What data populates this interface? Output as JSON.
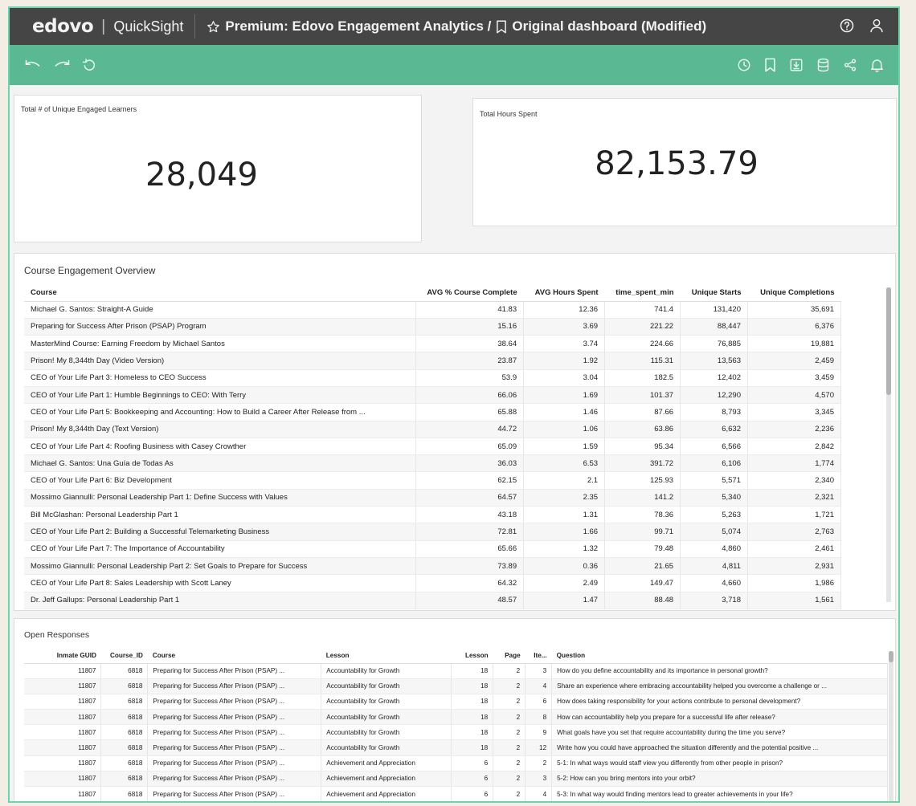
{
  "app": {
    "logo": "edovo",
    "separator": "|",
    "product": "QuickSight",
    "title_prefix": "Premium: Edovo Engagement Analytics /",
    "dashboard_name": "Original dashboard (Modified)"
  },
  "icons": {
    "topbar": [
      "star-icon",
      "bookmark-icon",
      "help-icon",
      "user-icon"
    ],
    "toolbar_left": [
      "undo-icon",
      "redo-icon",
      "reset-icon"
    ],
    "toolbar_right": [
      "schedule-icon",
      "bookmark-icon",
      "download-icon",
      "dataset-icon",
      "share-icon",
      "alert-icon"
    ]
  },
  "colors": {
    "topbar": "#454545",
    "toolbar": "#5ab892",
    "frame_border": "#6dd3a8"
  },
  "kpis": {
    "learners": {
      "label": "Total # of Unique Engaged Learners",
      "value": "28,049"
    },
    "hours": {
      "label": "Total Hours Spent",
      "value": "82,153.79"
    }
  },
  "course_engagement": {
    "title": "Course Engagement Overview",
    "columns": [
      "Course",
      "AVG % Course Complete",
      "AVG Hours Spent",
      "time_spent_min",
      "Unique Starts",
      "Unique Completions"
    ],
    "rows": [
      [
        "Michael G. Santos: Straight-A Guide",
        "41.83",
        "12.36",
        "741.4",
        "131,420",
        "35,691"
      ],
      [
        "Preparing for Success After Prison (PSAP) Program",
        "15.16",
        "3.69",
        "221.22",
        "88,447",
        "6,376"
      ],
      [
        "MasterMind Course: Earning Freedom by Michael Santos",
        "38.64",
        "3.74",
        "224.66",
        "76,885",
        "19,881"
      ],
      [
        "Prison! My 8,344th Day (Video Version)",
        "23.87",
        "1.92",
        "115.31",
        "13,563",
        "2,459"
      ],
      [
        "CEO of Your Life Part 3: Homeless to CEO Success",
        "53.9",
        "3.04",
        "182.5",
        "12,402",
        "3,459"
      ],
      [
        "CEO of Your Life Part 1: Humble Beginnings to CEO: With Terry",
        "66.06",
        "1.69",
        "101.37",
        "12,290",
        "4,570"
      ],
      [
        "CEO of Your Life Part 5: Bookkeeping and Accounting: How to Build a Career After Release from ...",
        "65.88",
        "1.46",
        "87.66",
        "8,793",
        "3,345"
      ],
      [
        "Prison! My 8,344th Day (Text Version)",
        "44.72",
        "1.06",
        "63.86",
        "6,632",
        "2,236"
      ],
      [
        "CEO of Your Life Part 4: Roofing Business with Casey Crowther",
        "65.09",
        "1.59",
        "95.34",
        "6,566",
        "2,842"
      ],
      [
        "Michael G. Santos: Una Guía de Todas As",
        "36.03",
        "6.53",
        "391.72",
        "6,106",
        "1,774"
      ],
      [
        "CEO of Your Life Part 6: Biz Development",
        "62.15",
        "2.1",
        "125.93",
        "5,571",
        "2,340"
      ],
      [
        "Mossimo Giannulli: Personal Leadership Part 1: Define Success with Values",
        "64.57",
        "2.35",
        "141.2",
        "5,340",
        "2,321"
      ],
      [
        "Bill McGlashan: Personal Leadership Part 1",
        "43.18",
        "1.31",
        "78.36",
        "5,263",
        "1,721"
      ],
      [
        "CEO of Your Life Part 2: Building a Successful Telemarketing Business",
        "72.81",
        "1.66",
        "99.71",
        "5,074",
        "2,763"
      ],
      [
        "CEO of Your Life Part 7: The Importance of Accountability",
        "65.66",
        "1.32",
        "79.48",
        "4,860",
        "2,461"
      ],
      [
        "Mossimo Giannulli: Personal Leadership Part 2: Set Goals to Prepare for Success",
        "73.89",
        "0.36",
        "21.65",
        "4,811",
        "2,931"
      ],
      [
        "CEO of Your Life Part 8: Sales Leadership with Scott Laney",
        "64.32",
        "2.49",
        "149.47",
        "4,660",
        "1,986"
      ],
      [
        "Dr. Jeff Gallups: Personal Leadership Part 1",
        "48.57",
        "1.47",
        "88.48",
        "3,718",
        "1,561"
      ]
    ]
  },
  "open_responses": {
    "title": "Open Responses",
    "columns": [
      "Inmate GUID",
      "Course_ID",
      "Course",
      "Lesson",
      "Lesson",
      "Page",
      "Ite...",
      "Question"
    ],
    "rows": [
      [
        "11807",
        "6818",
        "Preparing for Success After Prison (PSAP) ...",
        "Accountability for Growth",
        "18",
        "2",
        "3",
        "How do you define accountability and its importance in personal growth?"
      ],
      [
        "11807",
        "6818",
        "Preparing for Success After Prison (PSAP) ...",
        "Accountability for Growth",
        "18",
        "2",
        "4",
        "Share an experience where embracing accountability helped you overcome a challenge or ..."
      ],
      [
        "11807",
        "6818",
        "Preparing for Success After Prison (PSAP) ...",
        "Accountability for Growth",
        "18",
        "2",
        "6",
        "How does taking responsibility for your actions contribute to personal development?"
      ],
      [
        "11807",
        "6818",
        "Preparing for Success After Prison (PSAP) ...",
        "Accountability for Growth",
        "18",
        "2",
        "8",
        "How can accountability help you prepare for a successful life after release?"
      ],
      [
        "11807",
        "6818",
        "Preparing for Success After Prison (PSAP) ...",
        "Accountability for Growth",
        "18",
        "2",
        "9",
        "What goals have you set that require accountability during the time you serve?"
      ],
      [
        "11807",
        "6818",
        "Preparing for Success After Prison (PSAP) ...",
        "Accountability for Growth",
        "18",
        "2",
        "12",
        "Write how you could have approached the situation differently and the potential positive ..."
      ],
      [
        "11807",
        "6818",
        "Preparing for Success After Prison (PSAP) ...",
        "Achievement and Appreciation",
        "6",
        "2",
        "2",
        "5-1: In what ways would staff view you differently from other people in prison?"
      ],
      [
        "11807",
        "6818",
        "Preparing for Success After Prison (PSAP) ...",
        "Achievement and Appreciation",
        "6",
        "2",
        "3",
        "5-2: How can you bring mentors into your orbit?"
      ],
      [
        "11807",
        "6818",
        "Preparing for Success After Prison (PSAP) ...",
        "Achievement and Appreciation",
        "6",
        "2",
        "4",
        "5-3: In what way would finding mentors lead to greater achievements in your life?"
      ]
    ]
  }
}
